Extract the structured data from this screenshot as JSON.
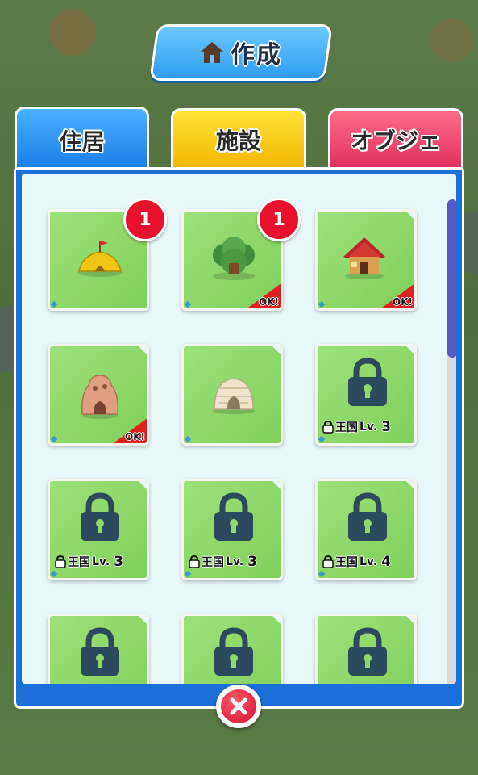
{
  "header": {
    "title": "作成"
  },
  "tabs": [
    {
      "label": "住居",
      "active": true,
      "color": "#1a7ae6"
    },
    {
      "label": "施設",
      "active": false,
      "color": "#f5b800"
    },
    {
      "label": "オブジェ",
      "active": false,
      "color": "#e03060"
    }
  ],
  "items": [
    {
      "name": "yellow-tent",
      "badge": "1",
      "ok": false,
      "locked": false
    },
    {
      "name": "leaf-hut",
      "badge": "1",
      "ok": true,
      "ok_label": "OK!",
      "locked": false
    },
    {
      "name": "red-wooden-house",
      "badge": "",
      "ok": true,
      "ok_label": "OK!",
      "locked": false
    },
    {
      "name": "clay-cave-house",
      "badge": "",
      "ok": true,
      "ok_label": "OK!",
      "locked": false
    },
    {
      "name": "stone-igloo",
      "badge": "",
      "ok": false,
      "locked": false
    },
    {
      "name": "locked-item",
      "locked": true,
      "lock_text": "王国",
      "lv_label": "Lv.",
      "lv_value": "3"
    },
    {
      "name": "locked-item",
      "locked": true,
      "lock_text": "王国",
      "lv_label": "Lv.",
      "lv_value": "3"
    },
    {
      "name": "locked-item",
      "locked": true,
      "lock_text": "王国",
      "lv_label": "Lv.",
      "lv_value": "3"
    },
    {
      "name": "locked-item",
      "locked": true,
      "lock_text": "王国",
      "lv_label": "Lv.",
      "lv_value": "4"
    },
    {
      "name": "locked-item",
      "locked": true
    },
    {
      "name": "locked-item",
      "locked": true
    },
    {
      "name": "locked-item",
      "locked": true
    }
  ],
  "colors": {
    "panel": "#1b6fd8",
    "card": "#8fd86a",
    "lock": "#2c4a5e",
    "badge": "#e8102a",
    "scroll_thumb": "#5b58c6"
  },
  "close_icon": "close-x-icon"
}
